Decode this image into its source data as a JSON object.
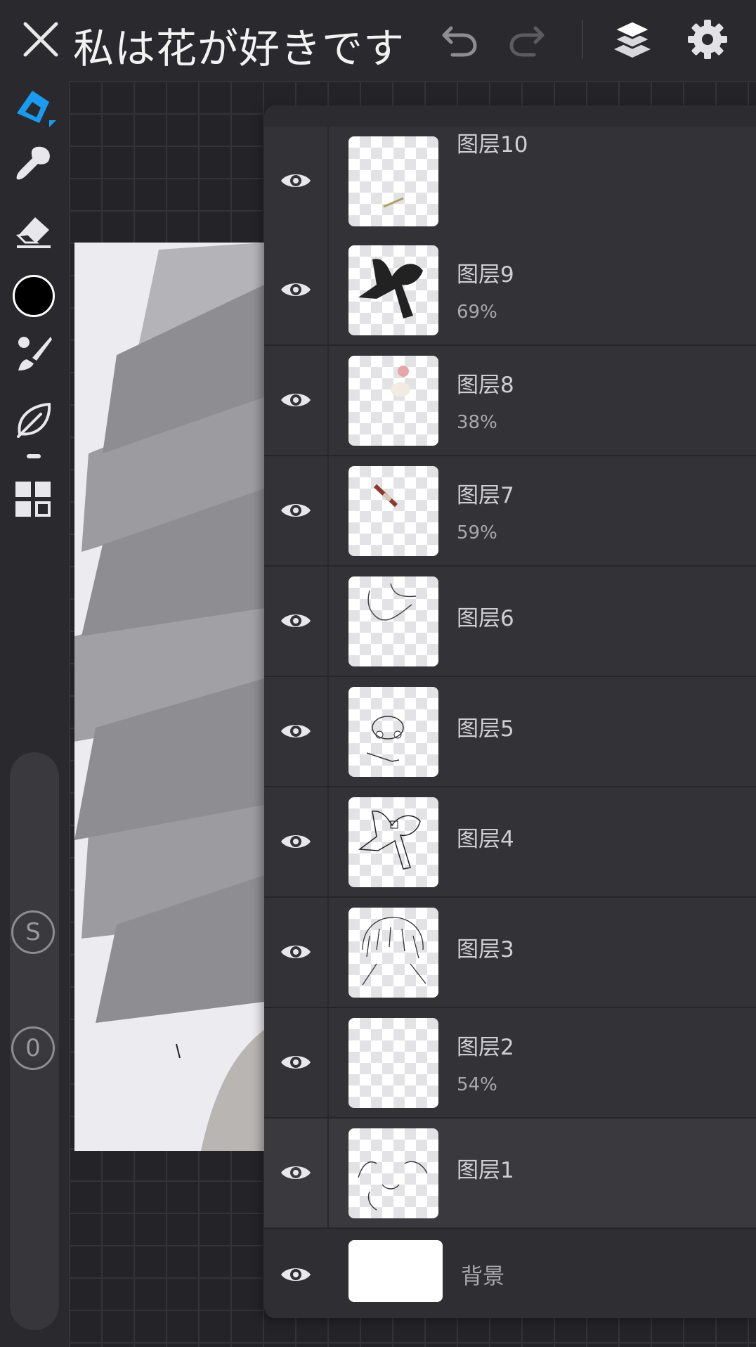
{
  "header": {
    "title": "私は花が好きです"
  },
  "left_toolbar": {
    "tools": [
      "pen-icon",
      "smudge-icon",
      "eraser-icon",
      "color-picker",
      "brush-icon",
      "leaf-icon",
      "grid-icon"
    ],
    "color_hex": "#000000",
    "button_s": "S",
    "button_0": "0"
  },
  "layers": [
    {
      "name": "图层10",
      "opacity": ""
    },
    {
      "name": "图层9",
      "opacity": "69%"
    },
    {
      "name": "图层8",
      "opacity": "38%"
    },
    {
      "name": "图层7",
      "opacity": "59%"
    },
    {
      "name": "图层6",
      "opacity": ""
    },
    {
      "name": "图层5",
      "opacity": ""
    },
    {
      "name": "图层4",
      "opacity": ""
    },
    {
      "name": "图层3",
      "opacity": ""
    },
    {
      "name": "图层2",
      "opacity": "54%"
    },
    {
      "name": "图层1",
      "opacity": ""
    }
  ],
  "background_layer": {
    "name": "背景"
  },
  "colors": {
    "accent": "#1a9bf0",
    "panel": "#303034",
    "toolbar": "#2a2a2e"
  }
}
